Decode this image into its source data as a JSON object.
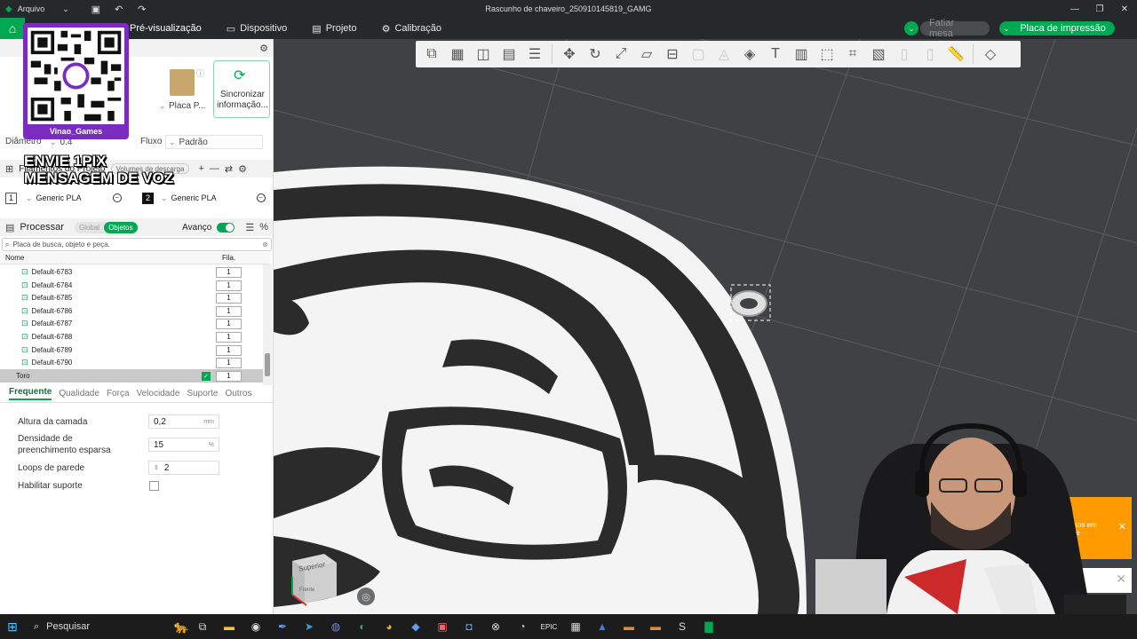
{
  "titlebar": {
    "menu_label": "Arquivo",
    "title": "Rascunho de chaveiro_250910145819_GAMG"
  },
  "topnav": {
    "tabs": [
      {
        "label": "Pré-visualização"
      },
      {
        "label": "Dispositivo"
      },
      {
        "label": "Projeto"
      },
      {
        "label": "Calibração"
      }
    ],
    "slice_plate": "Fatiar mesa",
    "print_plate": "Placa de impressão"
  },
  "printer": {
    "plate_label": "Placa P...",
    "sync_label": "Sincronizar informação..."
  },
  "nozzle": {
    "diameter_label": "Diâmetro",
    "diameter_value": "0.4",
    "flow_label": "Fluxo",
    "flow_value": "Padrão"
  },
  "filaments": {
    "title": "Filamentos do Projeto",
    "purge_label": "Volumes de descarga",
    "slots": [
      {
        "num": "1",
        "name": "Generic PLA"
      },
      {
        "num": "2",
        "name": "Generic PLA"
      }
    ]
  },
  "process": {
    "title": "Processar",
    "global_label": "Global",
    "objects_label": "Objetos",
    "advanced_label": "Avanço"
  },
  "object_list": {
    "search_placeholder": "Placa de busca, objeto e peça.",
    "col_name": "Nome",
    "col_fila": "Fila.",
    "rows": [
      {
        "name": "Default-6783",
        "fila": "1"
      },
      {
        "name": "Default-6784",
        "fila": "1"
      },
      {
        "name": "Default-6785",
        "fila": "1"
      },
      {
        "name": "Default-6786",
        "fila": "1"
      },
      {
        "name": "Default-6787",
        "fila": "1"
      },
      {
        "name": "Default-6788",
        "fila": "1"
      },
      {
        "name": "Default-6789",
        "fila": "1"
      },
      {
        "name": "Default-6790",
        "fila": "1"
      }
    ],
    "selected": {
      "name": "Toro",
      "fila": "1"
    }
  },
  "param_tabs": [
    "Frequente",
    "Qualidade",
    "Força",
    "Velocidade",
    "Suporte",
    "Outros"
  ],
  "params": {
    "layer_height": {
      "label": "Altura da camada",
      "value": "0,2",
      "unit": "mm"
    },
    "infill": {
      "label_line1": "Densidade de",
      "label_line2": "preenchimento esparsa",
      "value": "15",
      "unit": "%"
    },
    "walls": {
      "label": "Loops de parede",
      "value": "2"
    },
    "support": {
      "label": "Habilitar suporte"
    }
  },
  "overlay": {
    "qr_user": "Vinao_Games",
    "line1": "ENVIE 1PIX",
    "line2": "MENSAGEM DE VOZ"
  },
  "viewport": {
    "cube_top": "Superior",
    "cube_front": "Frente"
  },
  "notification": {
    "text_line1": "m",
    "text_line2": "bjetos em",
    "text_line3": "o de"
  },
  "taskbar": {
    "search_label": "Pesquisar"
  },
  "colors": {
    "accent": "#00a851",
    "titlebar": "#26292c",
    "viewport": "#3f4144",
    "qr_card": "#7b2cc0",
    "notification": "#ff9a00"
  }
}
